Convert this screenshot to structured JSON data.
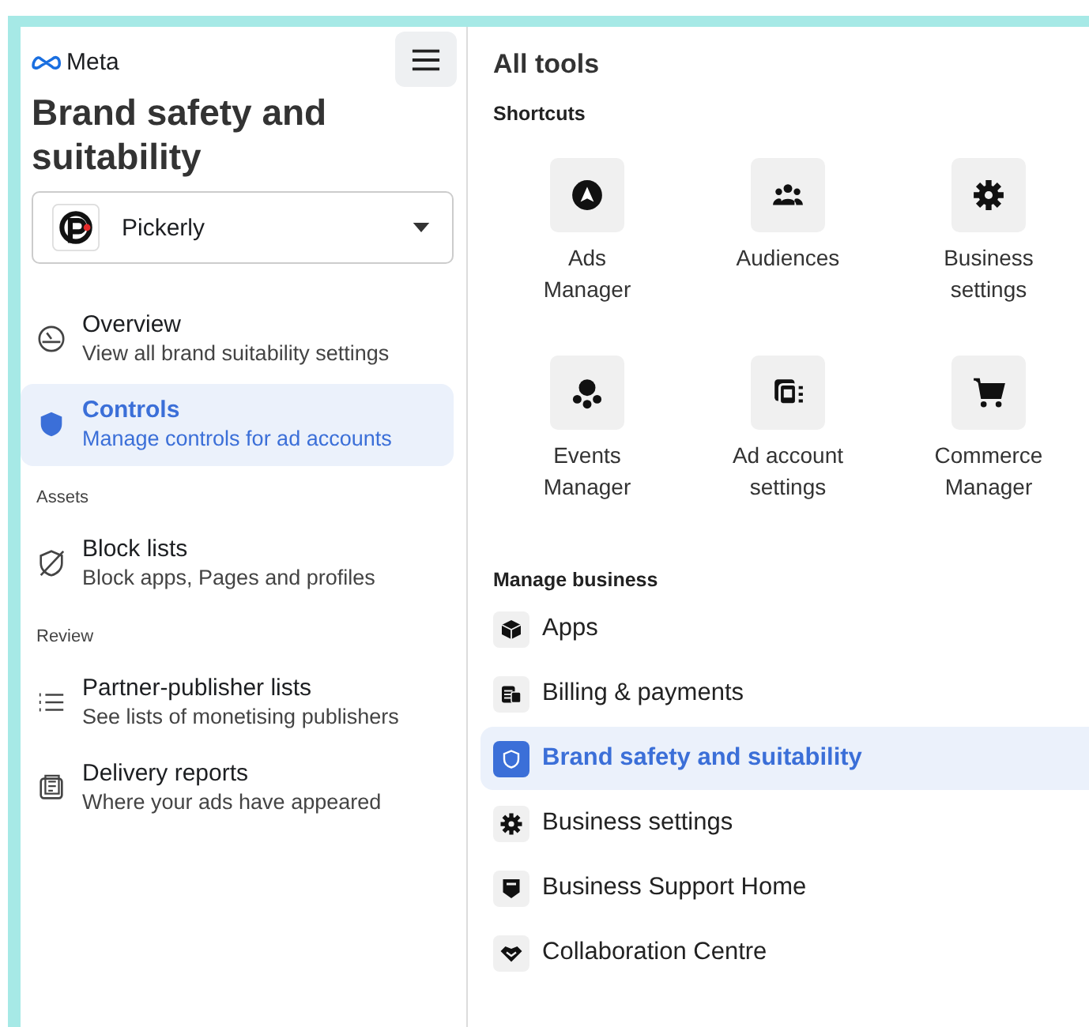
{
  "sidebar": {
    "logo": "Meta",
    "title": "Brand safety and suitability",
    "account": {
      "name": "Pickerly"
    },
    "sections": [
      {
        "items": [
          {
            "label": "Overview",
            "description": "View all brand suitability settings",
            "selected": false
          },
          {
            "label": "Controls",
            "description": "Manage controls for ad accounts",
            "selected": true
          }
        ]
      },
      {
        "heading": "Assets",
        "items": [
          {
            "label": "Block lists",
            "description": "Block apps, Pages and profiles",
            "selected": false
          }
        ]
      },
      {
        "heading": "Review",
        "items": [
          {
            "label": "Partner-publisher lists",
            "description": "See lists of monetising publishers",
            "selected": false
          },
          {
            "label": "Delivery reports",
            "description": "Where your ads have appeared",
            "selected": false
          }
        ]
      }
    ]
  },
  "main": {
    "title": "All tools",
    "shortcuts_heading": "Shortcuts",
    "shortcuts": [
      {
        "label": "Ads Manager"
      },
      {
        "label": "Audiences"
      },
      {
        "label": "Business settings"
      },
      {
        "label": "Events Manager"
      },
      {
        "label": "Ad account settings"
      },
      {
        "label": "Commerce Manager"
      }
    ],
    "manage_heading": "Manage business",
    "manage_items": [
      {
        "label": "Apps",
        "selected": false
      },
      {
        "label": "Billing & payments",
        "selected": false
      },
      {
        "label": "Brand safety and suitability",
        "selected": true
      },
      {
        "label": "Business settings",
        "selected": false
      },
      {
        "label": "Business Support Home",
        "selected": false
      },
      {
        "label": "Collaboration Centre",
        "selected": false
      }
    ]
  }
}
